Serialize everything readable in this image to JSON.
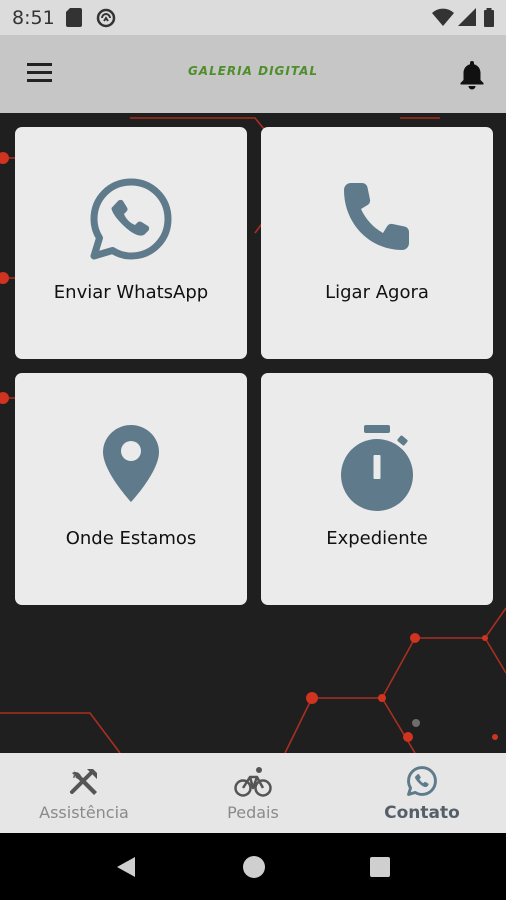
{
  "status_bar": {
    "time": "8:51"
  },
  "app_bar": {
    "logo_text": "GALERIA DIGITAL"
  },
  "cards": [
    {
      "label": "Enviar WhatsApp",
      "icon": "whatsapp-icon"
    },
    {
      "label": "Ligar Agora",
      "icon": "phone-icon"
    },
    {
      "label": "Onde Estamos",
      "icon": "location-pin-icon"
    },
    {
      "label": "Expediente",
      "icon": "stopwatch-icon"
    }
  ],
  "bottom_nav": [
    {
      "label": "Assistência",
      "icon": "tools-icon",
      "active": false
    },
    {
      "label": "Pedais",
      "icon": "bicycle-icon",
      "active": false
    },
    {
      "label": "Contato",
      "icon": "whatsapp-icon",
      "active": true
    }
  ],
  "colors": {
    "icon": "#5e7a8b",
    "accent_red": "#d0331f",
    "logo_green": "#4d8f2a",
    "card": "#ebebeb"
  }
}
